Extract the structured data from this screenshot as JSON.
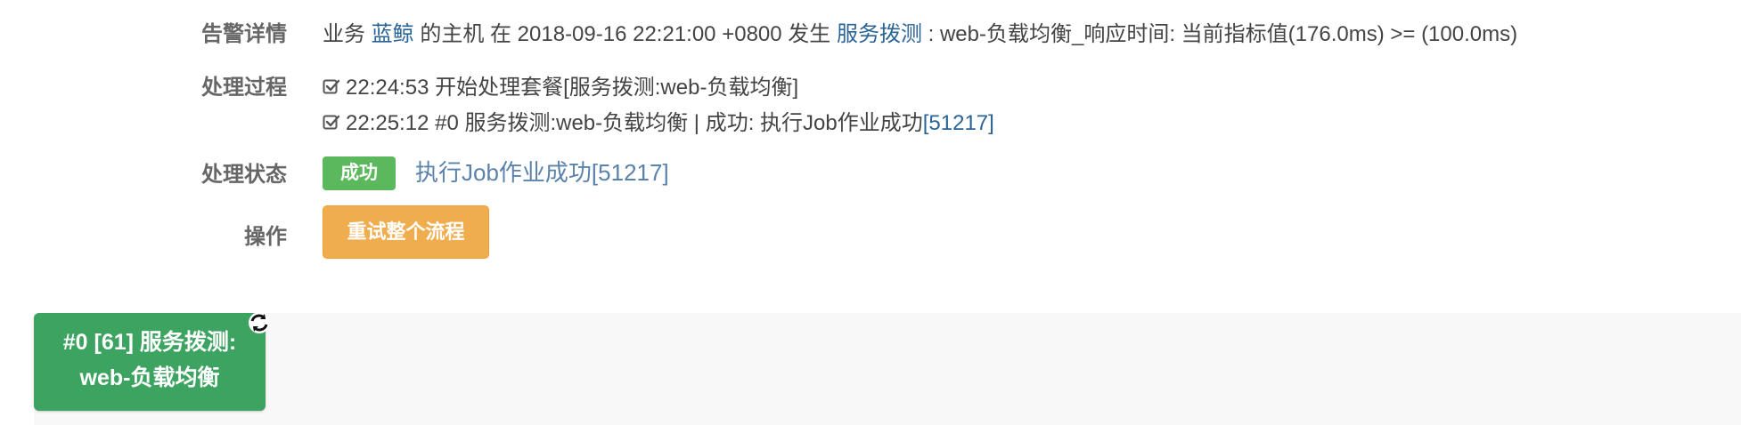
{
  "alert": {
    "label": "告警详情",
    "prefix": "业务",
    "business_link": "蓝鲸",
    "middle": "的主机 在 2018-09-16 22:21:00 +0800 发生",
    "type_link": "服务拨测",
    "suffix": ": web-负载均衡_响应时间: 当前指标值(176.0ms) >= (100.0ms)"
  },
  "process": {
    "label": "处理过程",
    "steps": [
      {
        "text": "22:24:53 开始处理套餐[服务拨测:web-负载均衡]",
        "link": ""
      },
      {
        "text": "22:25:12 #0 服务拨测:web-负载均衡 | 成功: 执行Job作业成功",
        "link": "[51217]"
      }
    ]
  },
  "status": {
    "label": "处理状态",
    "badge": "成功",
    "link_text": "执行Job作业成功[51217]"
  },
  "actions": {
    "label": "操作",
    "retry_button": "重试整个流程"
  },
  "flow": {
    "node_line1": "#0 [61] 服务拨测:",
    "node_line2": "web-负载均衡"
  },
  "colors": {
    "link": "#2a6496",
    "success": "#5cb85c",
    "warning": "#f0ad4e",
    "node": "#3da360"
  },
  "icons": {
    "step": "check-square-icon",
    "node": "refresh-icon"
  }
}
